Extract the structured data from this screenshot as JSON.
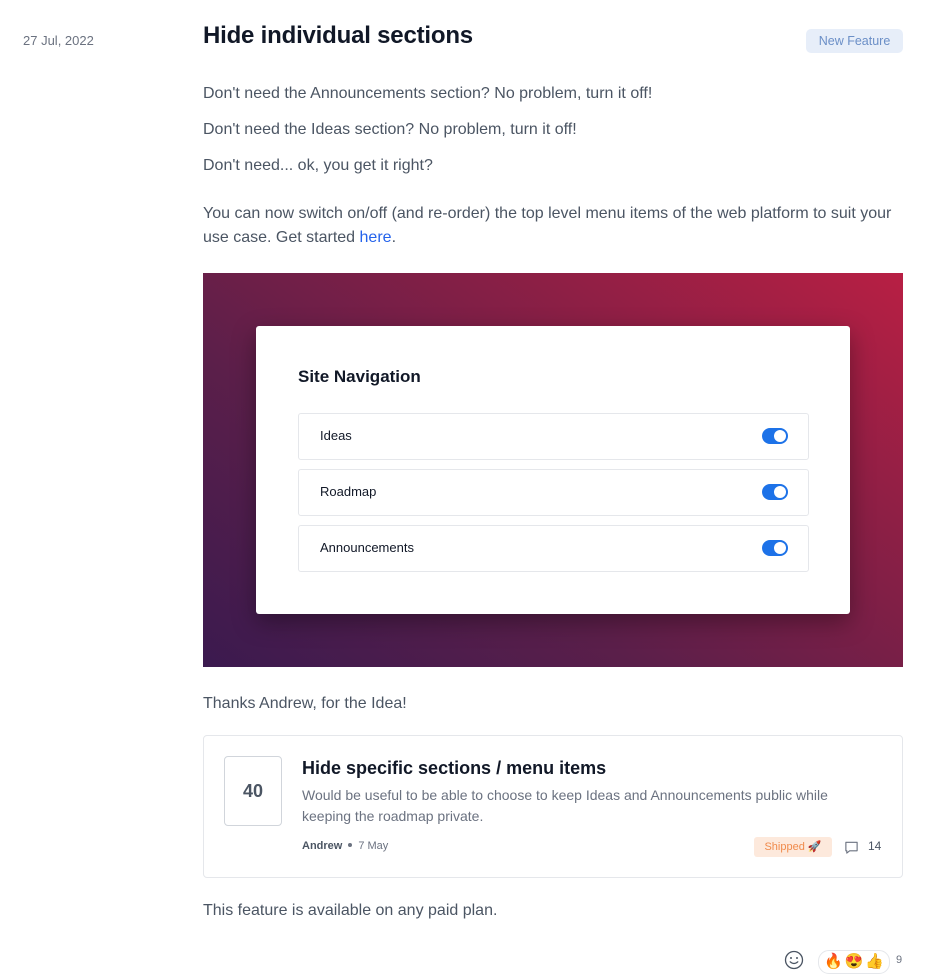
{
  "post": {
    "date": "27 Jul, 2022",
    "title": "Hide individual sections",
    "badge": "New Feature",
    "paragraphs": [
      "Don't need the Announcements section? No problem, turn it off!",
      "Don't need the Ideas section? No problem, turn it off!",
      "Don't need... ok, you get it right?"
    ],
    "switch_text": "You can now switch on/off (and re-order) the top level menu items of the web platform to suit your use case. Get started ",
    "link_text": "here",
    "link_suffix": ".",
    "thanks": "Thanks Andrew, for the Idea!",
    "availability": "This feature is available on any paid plan."
  },
  "hero": {
    "card_title": "Site Navigation",
    "items": [
      {
        "label": "Ideas",
        "enabled": true
      },
      {
        "label": "Roadmap",
        "enabled": true
      },
      {
        "label": "Announcements",
        "enabled": true
      }
    ],
    "colors": {
      "gradient_start": "#3b1a4f",
      "gradient_end": "#b81f44",
      "toggle": "#1d72e8"
    }
  },
  "idea": {
    "votes": "40",
    "title": "Hide specific sections / menu items",
    "description": "Would be useful to be able to choose to keep Ideas and Announcements public while keeping the roadmap private.",
    "author": "Andrew",
    "date": "7 May",
    "status": "Shipped 🚀",
    "comments": "14"
  },
  "reactions": {
    "emojis": [
      "🔥",
      "😍",
      "👍"
    ],
    "count": "9",
    "add_icon": "smiley-icon"
  },
  "colors": {
    "link": "#2563eb",
    "badge_bg": "#e7eef9",
    "badge_text": "#6b8fc7",
    "shipped_bg": "#fde9dc",
    "shipped_text": "#f08a4b"
  }
}
